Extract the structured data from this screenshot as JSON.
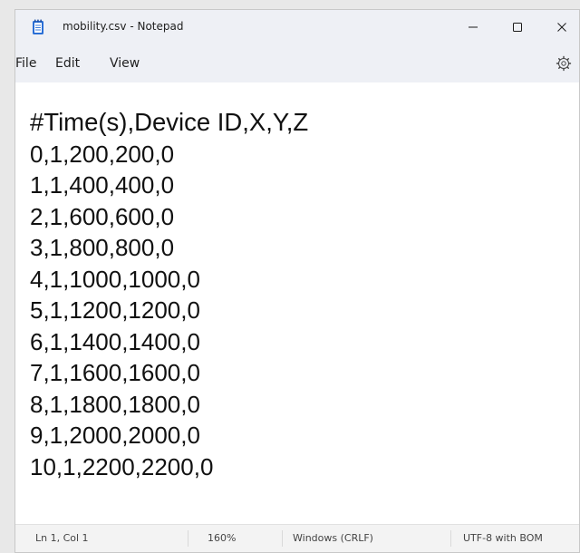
{
  "window": {
    "title": "mobility.csv - Notepad"
  },
  "menu": {
    "items": [
      "File",
      "Edit",
      "View"
    ]
  },
  "icons": {
    "app": "notepad-icon",
    "minimize": "minimize-icon",
    "maximize": "maximize-icon",
    "close": "close-icon",
    "settings": "gear-icon"
  },
  "editor": {
    "lines": [
      "#Time(s),Device ID,X,Y,Z",
      "0,1,200,200,0",
      "1,1,400,400,0",
      "2,1,600,600,0",
      "3,1,800,800,0",
      "4,1,1000,1000,0",
      "5,1,1200,1200,0",
      "6,1,1400,1400,0",
      "7,1,1600,1600,0",
      "8,1,1800,1800,0",
      "9,1,2000,2000,0",
      "10,1,2200,2200,0"
    ]
  },
  "status": {
    "position": "Ln 1, Col 1",
    "zoom": "160%",
    "line_ending": "Windows (CRLF)",
    "encoding": "UTF-8 with BOM"
  },
  "colors": {
    "titlebar_bg": "#eef0f5",
    "editor_bg": "#ffffff",
    "statusbar_bg": "#f3f3f3",
    "icon_accent": "#2a6fd6"
  }
}
